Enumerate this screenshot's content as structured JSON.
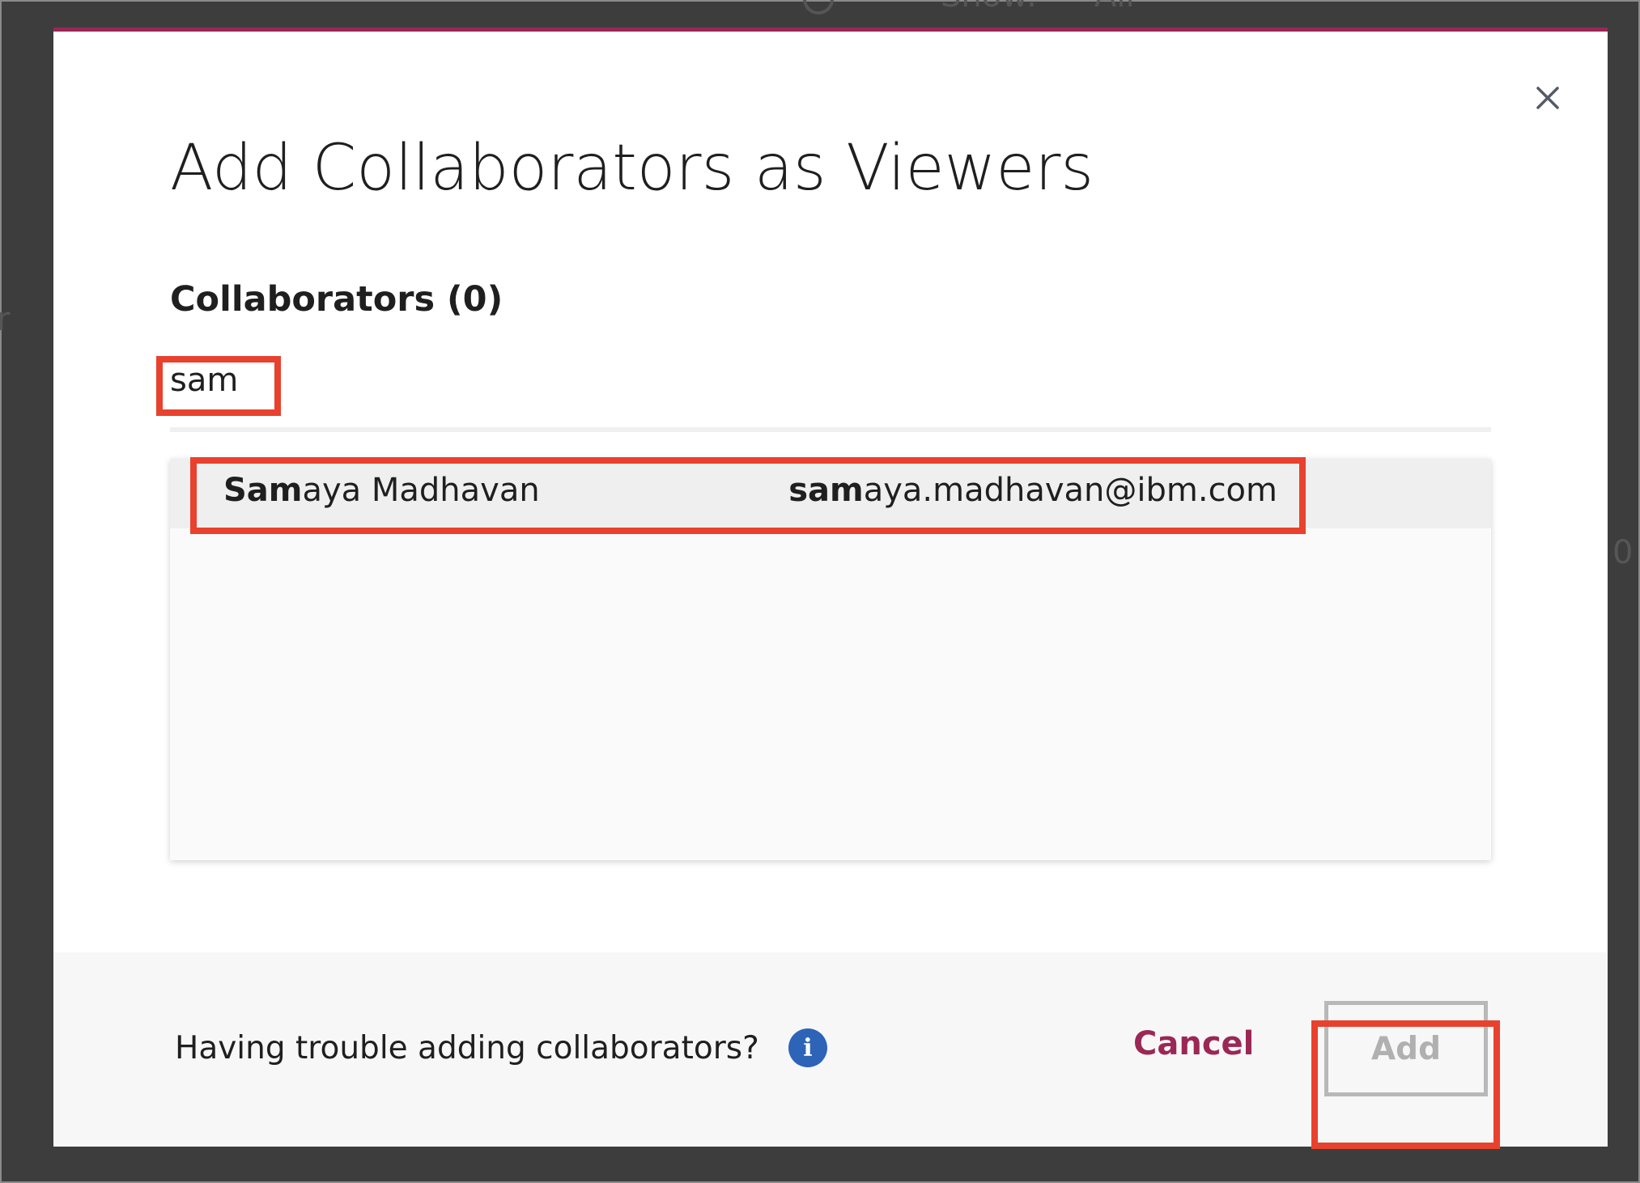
{
  "background": {
    "fragments": [
      "Show:",
      "All",
      "r",
      "0"
    ]
  },
  "modal": {
    "title": "Add Collaborators as Viewers",
    "collaborators_label": "Collaborators (0)",
    "search": {
      "value": "sam",
      "placeholder": ""
    },
    "results": [
      {
        "name_match": "Sam",
        "name_rest": "aya Madhavan",
        "email_match": "sam",
        "email_rest": "aya.madhavan@ibm.com"
      }
    ],
    "footer": {
      "help_text": "Having trouble adding collaborators?",
      "info_icon": "i",
      "cancel_label": "Cancel",
      "add_label": "Add"
    }
  },
  "colors": {
    "accent": "#9b2755",
    "highlight": "#e8412d",
    "info": "#2d64b8"
  },
  "icons": [
    "search-icon",
    "close-icon",
    "info-icon"
  ]
}
